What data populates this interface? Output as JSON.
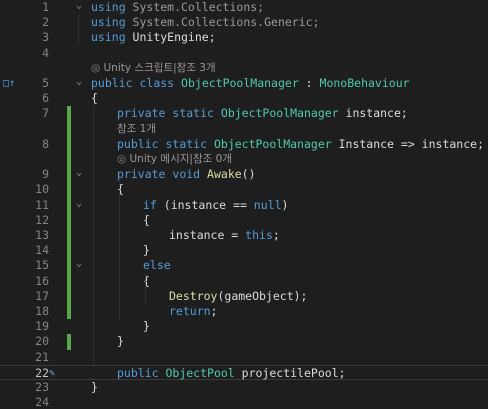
{
  "editor": {
    "margin_icon_label": "□↑",
    "pen_icon": "✎",
    "fold_glyph": "⌄",
    "lens_icon": "◎",
    "lines": [
      {
        "n": "1",
        "fold": true,
        "indent": 0,
        "tokens": [
          [
            "kw",
            "using"
          ],
          [
            "gray",
            " System.Collections;"
          ]
        ]
      },
      {
        "n": "2",
        "indent": 0,
        "tokens": [
          [
            "kw",
            "using"
          ],
          [
            "gray",
            " System.Collections.Generic;"
          ]
        ]
      },
      {
        "n": "3",
        "indent": 0,
        "tokens": [
          [
            "kw",
            "using"
          ],
          [
            "p",
            " UnityEngine;"
          ]
        ]
      },
      {
        "n": "4",
        "indent": 0,
        "tokens": []
      },
      {
        "n": "",
        "lens": "Unity 스크립트|참조 3개",
        "indent": 0
      },
      {
        "n": "5",
        "fold": true,
        "margin": true,
        "indent": 0,
        "tokens": [
          [
            "kw",
            "public"
          ],
          [
            "p",
            " "
          ],
          [
            "kw",
            "class"
          ],
          [
            "p",
            " "
          ],
          [
            "ty",
            "ObjectPoolManager"
          ],
          [
            "p",
            " : "
          ],
          [
            "ty",
            "MonoBehaviour"
          ]
        ]
      },
      {
        "n": "6",
        "indent": 0,
        "tokens": [
          [
            "p",
            "{"
          ]
        ]
      },
      {
        "n": "7",
        "indent": 1,
        "tokens": [
          [
            "kw",
            "private"
          ],
          [
            "p",
            " "
          ],
          [
            "kw",
            "static"
          ],
          [
            "p",
            " "
          ],
          [
            "ty",
            "ObjectPoolManager"
          ],
          [
            "p",
            " instance;"
          ]
        ]
      },
      {
        "n": "",
        "lens": "참조 1개",
        "indent": 1
      },
      {
        "n": "8",
        "indent": 1,
        "tokens": [
          [
            "kw",
            "public"
          ],
          [
            "p",
            " "
          ],
          [
            "kw",
            "static"
          ],
          [
            "p",
            " "
          ],
          [
            "ty",
            "ObjectPoolManager"
          ],
          [
            "p",
            " Instance => instance;"
          ]
        ]
      },
      {
        "n": "",
        "lens": "Unity 메시지|참조 0개",
        "icon": true,
        "indent": 1
      },
      {
        "n": "9",
        "fold": true,
        "indent": 1,
        "tokens": [
          [
            "kw",
            "private"
          ],
          [
            "p",
            " "
          ],
          [
            "kw",
            "void"
          ],
          [
            "p",
            " "
          ],
          [
            "fn",
            "Awake"
          ],
          [
            "p",
            "()"
          ]
        ]
      },
      {
        "n": "10",
        "indent": 1,
        "tokens": [
          [
            "p",
            "{"
          ]
        ]
      },
      {
        "n": "11",
        "fold": true,
        "indent": 2,
        "tokens": [
          [
            "kw",
            "if"
          ],
          [
            "p",
            " (instance == "
          ],
          [
            "kw",
            "null"
          ],
          [
            "p",
            ")"
          ]
        ]
      },
      {
        "n": "12",
        "indent": 2,
        "tokens": [
          [
            "p",
            "{"
          ]
        ]
      },
      {
        "n": "13",
        "indent": 3,
        "tokens": [
          [
            "p",
            "instance = "
          ],
          [
            "kw",
            "this"
          ],
          [
            "p",
            ";"
          ]
        ]
      },
      {
        "n": "14",
        "indent": 2,
        "tokens": [
          [
            "p",
            "}"
          ]
        ]
      },
      {
        "n": "15",
        "fold": true,
        "indent": 2,
        "tokens": [
          [
            "kw",
            "else"
          ]
        ]
      },
      {
        "n": "16",
        "indent": 2,
        "tokens": [
          [
            "p",
            "{"
          ]
        ]
      },
      {
        "n": "17",
        "indent": 3,
        "tokens": [
          [
            "fn",
            "Destroy"
          ],
          [
            "p",
            "(gameObject);"
          ]
        ]
      },
      {
        "n": "18",
        "indent": 3,
        "tokens": [
          [
            "kw",
            "return"
          ],
          [
            "p",
            ";"
          ]
        ]
      },
      {
        "n": "19",
        "indent": 2,
        "tokens": [
          [
            "p",
            "}"
          ]
        ]
      },
      {
        "n": "20",
        "indent": 1,
        "tokens": [
          [
            "p",
            "}"
          ]
        ]
      },
      {
        "n": "21",
        "indent": 0,
        "tokens": []
      },
      {
        "n": "22",
        "current": true,
        "pen": true,
        "indent": 1,
        "tokens": [
          [
            "kw",
            "public"
          ],
          [
            "p",
            " "
          ],
          [
            "ty",
            "ObjectPool"
          ],
          [
            "p",
            " projectilePool;"
          ]
        ]
      },
      {
        "n": "23",
        "indent": 0,
        "tokens": [
          [
            "p",
            "}"
          ]
        ]
      },
      {
        "n": "24",
        "indent": 0,
        "tokens": []
      }
    ]
  }
}
